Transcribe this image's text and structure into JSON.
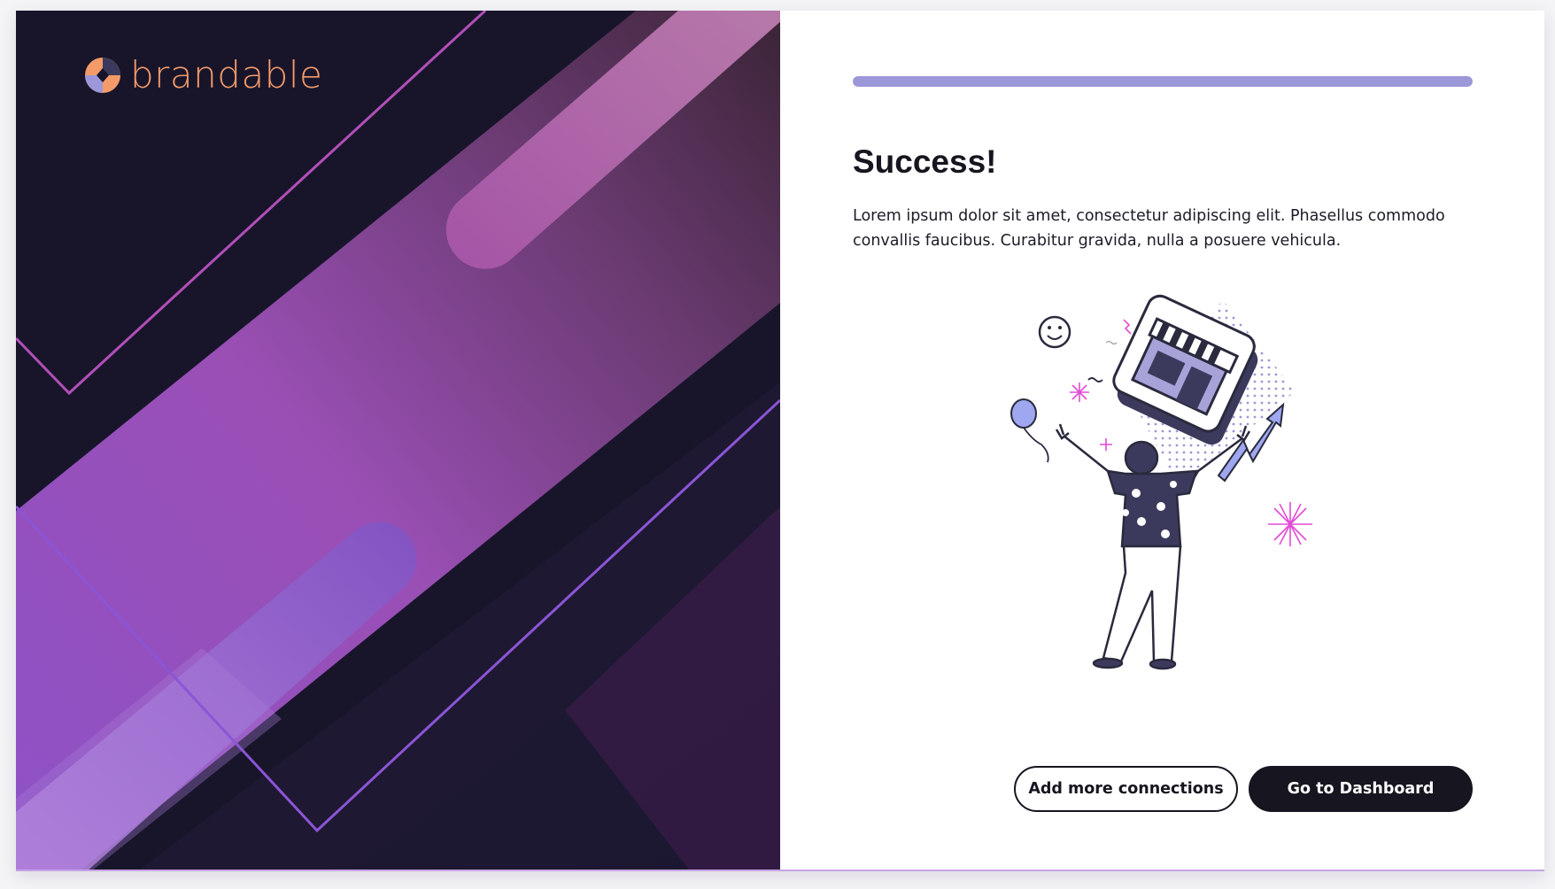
{
  "brand": {
    "name": "brandable",
    "logo_icon": "brandable-logo-icon",
    "accent_color": "#f59b69"
  },
  "progress": {
    "value_percent": 100,
    "color": "#9b97d9"
  },
  "content": {
    "title": "Success!",
    "description": "Lorem ipsum dolor sit amet, consectetur adipiscing elit. Phasellus commodo convallis faucibus. Curabitur gravida, nulla a posuere vehicula.",
    "illustration": "celebrating-person-store-illustration"
  },
  "actions": {
    "secondary_label": "Add more connections",
    "primary_label": "Go to Dashboard"
  },
  "colors": {
    "panel_dark": "#16142a",
    "gradient_purple": "#9a4fc4",
    "button_dark": "#17151f"
  }
}
